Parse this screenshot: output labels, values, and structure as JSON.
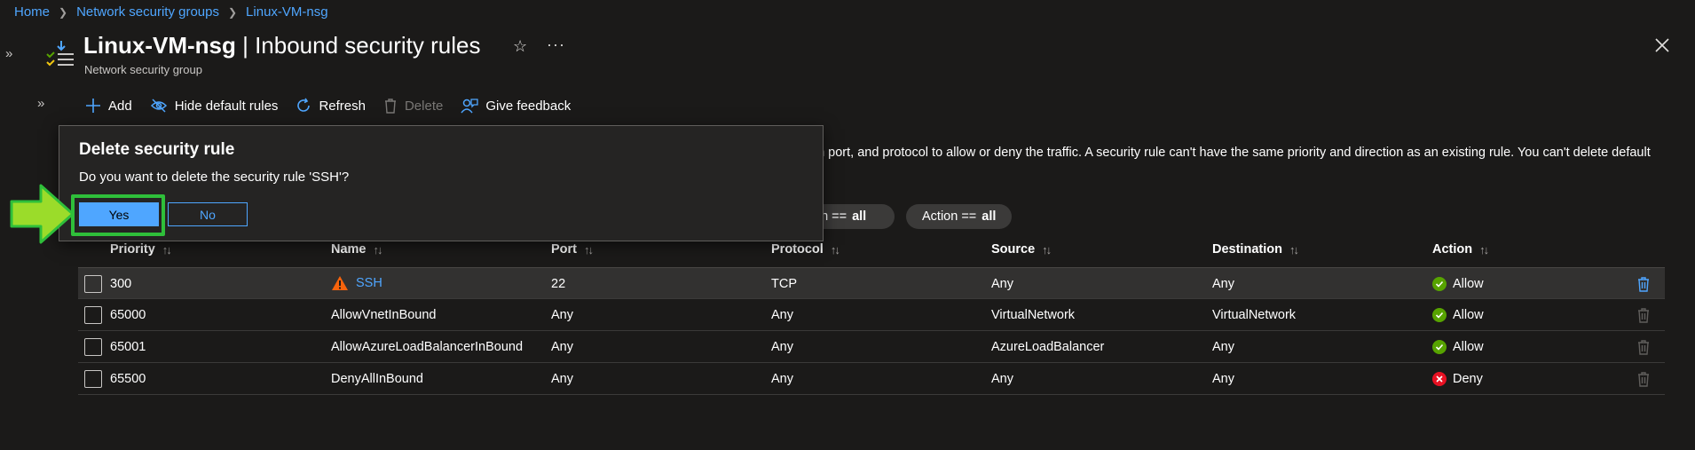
{
  "breadcrumb": {
    "items": [
      "Home",
      "Network security groups",
      "Linux-VM-nsg"
    ]
  },
  "header": {
    "title": "Linux-VM-nsg",
    "title_separator": " | ",
    "section": "Inbound security rules",
    "subtitle": "Network security group"
  },
  "toolbar": {
    "add": "Add",
    "hide_default": "Hide default rules",
    "refresh": "Refresh",
    "delete": "Delete",
    "feedback": "Give feedback"
  },
  "description": {
    "line1_visible": "on port, and protocol to allow or deny the traffic. A security rule can't have the same priority and direction as an existing rule. You can't delete default"
  },
  "filters": [
    {
      "label": "on ==",
      "value": "all"
    },
    {
      "label": "Action ==",
      "value": "all"
    }
  ],
  "table": {
    "columns": [
      "Priority",
      "Name",
      "Port",
      "Protocol",
      "Source",
      "Destination",
      "Action"
    ],
    "rows": [
      {
        "priority": "300",
        "name": "SSH",
        "port": "22",
        "protocol": "TCP",
        "source": "Any",
        "destination": "Any",
        "action": "Allow"
      },
      {
        "priority": "65000",
        "name": "AllowVnetInBound",
        "port": "Any",
        "protocol": "Any",
        "source": "VirtualNetwork",
        "destination": "VirtualNetwork",
        "action": "Allow"
      },
      {
        "priority": "65001",
        "name": "AllowAzureLoadBalancerInBound",
        "port": "Any",
        "protocol": "Any",
        "source": "AzureLoadBalancer",
        "destination": "Any",
        "action": "Allow"
      },
      {
        "priority": "65500",
        "name": "DenyAllInBound",
        "port": "Any",
        "protocol": "Any",
        "source": "Any",
        "destination": "Any",
        "action": "Deny"
      }
    ]
  },
  "dialog": {
    "title": "Delete security rule",
    "message": "Do you want to delete the security rule 'SSH'?",
    "yes_label": "Yes",
    "no_label": "No"
  },
  "colors": {
    "accent": "#4fa6ff",
    "allow": "#57a300",
    "deny": "#e81123",
    "warning": "#f7630c",
    "highlight": "#2fbf3a",
    "arrow": "#9bdc2a"
  },
  "icons": {
    "resource": "nsg-rules-icon",
    "star": "star-icon",
    "more": "ellipsis-icon",
    "close": "close-icon",
    "warning": "warning-icon",
    "allow": "check-circle-icon",
    "deny": "x-circle-icon",
    "trash": "trash-icon"
  }
}
